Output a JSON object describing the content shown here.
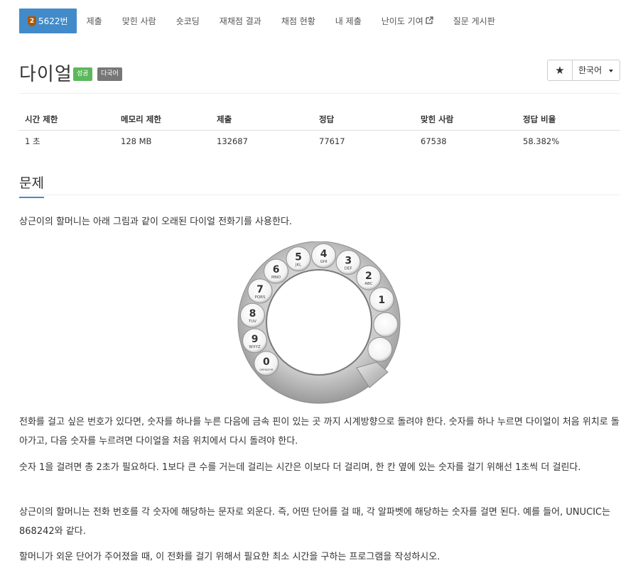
{
  "nav": {
    "problem_number": "5622번",
    "tier_badge": "2",
    "items": [
      "제출",
      "맞힌 사람",
      "숏코딩",
      "재채점 결과",
      "채점 현황",
      "내 제출",
      "난이도 기여",
      "질문 게시판"
    ]
  },
  "problem": {
    "title": "다이얼",
    "labels": [
      "성공",
      "다국어"
    ],
    "star": "★",
    "language": "한국어"
  },
  "info": {
    "headers": [
      "시간 제한",
      "메모리 제한",
      "제출",
      "정답",
      "맞힌 사람",
      "정답 비율"
    ],
    "values": [
      "1 초",
      "128 MB",
      "132687",
      "77617",
      "67538",
      "58.382%"
    ]
  },
  "section": {
    "title": "문제",
    "paragraphs": [
      "상근이의 할머니는 아래 그림과 같이 오래된 다이얼 전화기를 사용한다.",
      "전화를 걸고 싶은 번호가 있다면, 숫자를 하나를 누른 다음에 금속 핀이 있는 곳 까지 시계방향으로 돌려야 한다. 숫자를 하나 누르면 다이얼이 처음 위치로 돌아가고, 다음 숫자를 누르려면 다이얼을 처음 위치에서 다시 돌려야 한다.",
      "숫자 1을 걸려면 총 2초가 필요하다. 1보다 큰 수를 거는데 걸리는 시간은 이보다 더 걸리며, 한 칸 옆에 있는 숫자를 걸기 위해선 1초씩 더 걸린다.",
      "상근이의 할머니는 전화 번호를 각 숫자에 해당하는 문자로 외운다. 즉, 어떤 단어를 걸 때, 각 알파벳에 해당하는 숫자를 걸면 된다. 예를 들어, UNUCIC는 868242와 같다.",
      "할머니가 외운 단어가 주어졌을 때, 이 전화를 걸기 위해서 필요한 최소 시간을 구하는 프로그램을 작성하시오."
    ]
  },
  "dial": {
    "keys": [
      {
        "num": "1",
        "letters": ""
      },
      {
        "num": "2",
        "letters": "ABC"
      },
      {
        "num": "3",
        "letters": "DEF"
      },
      {
        "num": "4",
        "letters": "GHI"
      },
      {
        "num": "5",
        "letters": "JKL"
      },
      {
        "num": "6",
        "letters": "MNO"
      },
      {
        "num": "7",
        "letters": "PQRS"
      },
      {
        "num": "8",
        "letters": "TUV"
      },
      {
        "num": "9",
        "letters": "WXYZ"
      },
      {
        "num": "0",
        "letters": "OPERATOR"
      }
    ]
  }
}
